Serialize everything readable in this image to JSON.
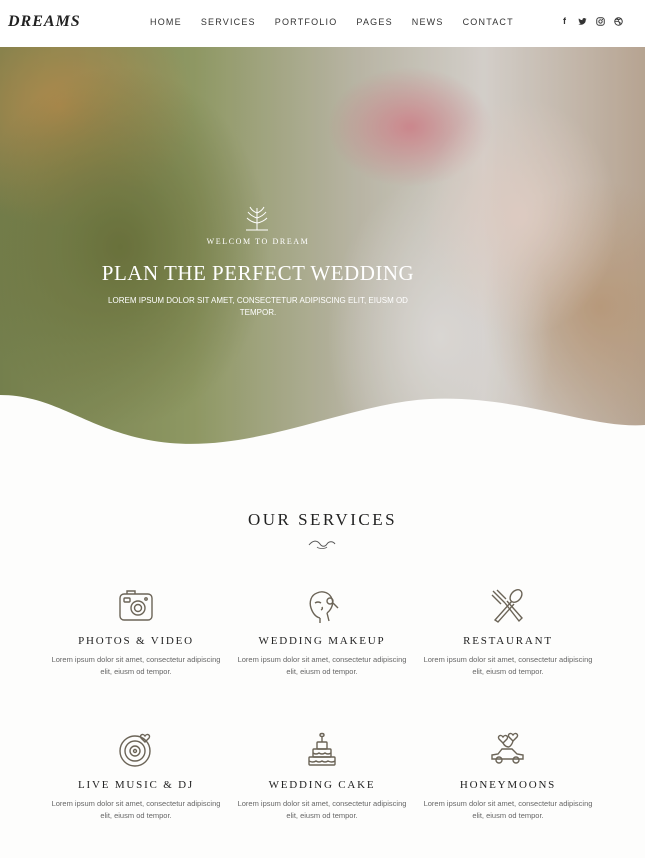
{
  "header": {
    "logo": "DREAMS",
    "nav": [
      "HOME",
      "SERVICES",
      "PORTFOLIO",
      "PAGES",
      "NEWS",
      "CONTACT"
    ],
    "social_icons": [
      "facebook-icon",
      "twitter-icon",
      "instagram-icon",
      "dribbble-icon"
    ]
  },
  "hero": {
    "welcome": "WELCOM TO DREAM",
    "title": "PLAN THE PERFECT WEDDING",
    "subtitle": "LOREM IPSUM DOLOR SIT AMET, CONSECTETUR ADIPISCING ELIT, EIUSM OD TEMPOR."
  },
  "services": {
    "title": "OUR SERVICES",
    "items": [
      {
        "icon": "camera-icon",
        "title": "PHOTOS & VIDEO",
        "desc": "Lorem ipsum dolor sit amet, consectetur adipiscing elit, eiusm od tempor."
      },
      {
        "icon": "makeup-icon",
        "title": "WEDDING MAKEUP",
        "desc": "Lorem ipsum dolor sit amet, consectetur adipiscing elit, eiusm od tempor."
      },
      {
        "icon": "fork-spoon-icon",
        "title": "RESTAURANT",
        "desc": "Lorem ipsum dolor sit amet, consectetur adipiscing elit, eiusm od tempor."
      },
      {
        "icon": "vinyl-record-icon",
        "title": "LIVE MUSIC & DJ",
        "desc": "Lorem ipsum dolor sit amet, consectetur adipiscing elit, eiusm od tempor."
      },
      {
        "icon": "cake-icon",
        "title": "WEDDING CAKE",
        "desc": "Lorem ipsum dolor sit amet, consectetur adipiscing elit, eiusm od tempor."
      },
      {
        "icon": "car-hearts-icon",
        "title": "HONEYMOONS",
        "desc": "Lorem ipsum dolor sit amet, consectetur adipiscing elit, eiusm od tempor."
      }
    ]
  },
  "colors": {
    "icon_stroke": "#6b6457",
    "text_dark": "#222222",
    "text_muted": "#666666"
  }
}
